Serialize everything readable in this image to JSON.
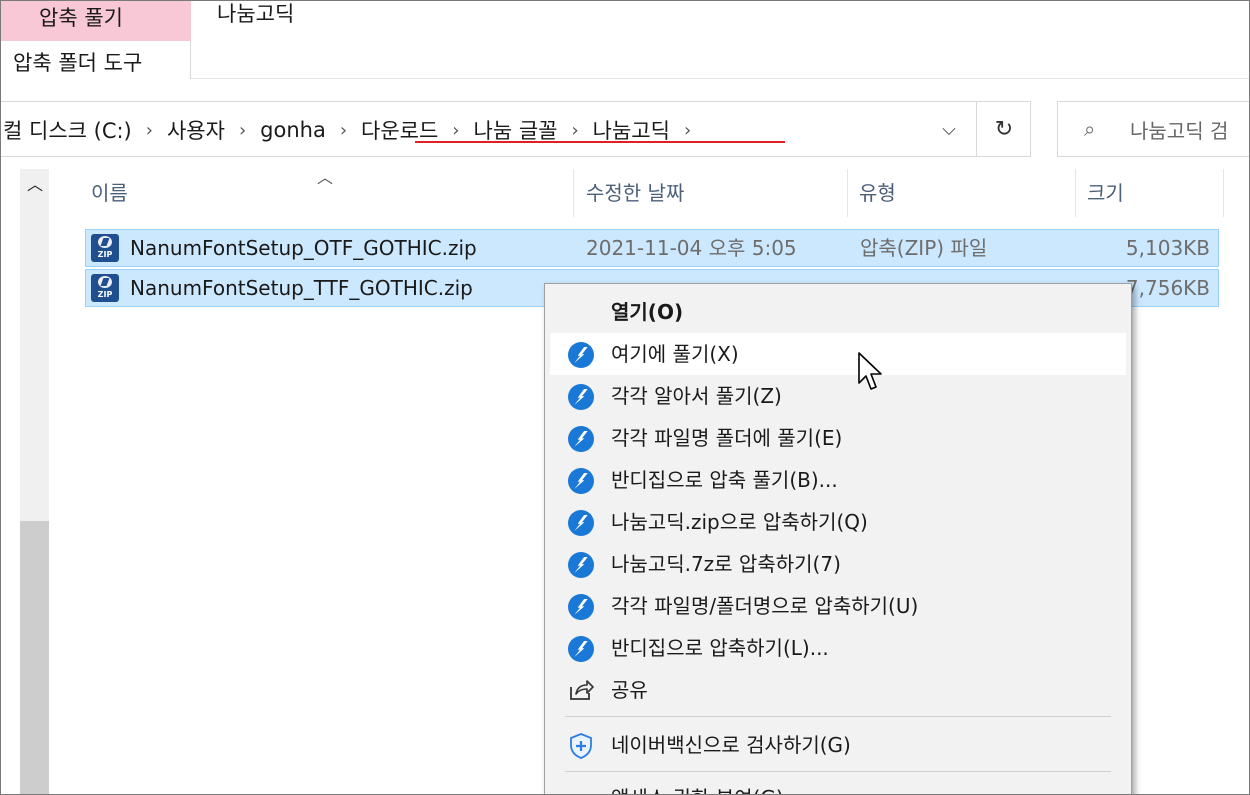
{
  "ribbon": {
    "extract_tab": "압축 풀기",
    "tools_tab": "압축 폴더 도구",
    "folder_tab": "나눔고딕"
  },
  "address": {
    "crumbs": [
      "컬 디스크 (C:)",
      "사용자",
      "gonha",
      "다운로드",
      "나눔 글꼴",
      "나눔고딕"
    ],
    "refresh_icon": "refresh-icon",
    "search_placeholder": "나눔고딕 검"
  },
  "columns": {
    "name": "이름",
    "modified": "수정한 날짜",
    "type": "유형",
    "size": "크기"
  },
  "files": [
    {
      "name": "NanumFontSetup_OTF_GOTHIC.zip",
      "modified": "2021-11-04 오후 5:05",
      "type": "압축(ZIP) 파일",
      "size": "5,103KB"
    },
    {
      "name": "NanumFontSetup_TTF_GOTHIC.zip",
      "modified": "",
      "type": "",
      "size": "7,756KB"
    }
  ],
  "context_menu": {
    "items": [
      {
        "label": "열기(O)",
        "icon": "",
        "bold": true
      },
      {
        "label": "여기에 풀기(X)",
        "icon": "bandizip-icon",
        "highlighted": true
      },
      {
        "label": "각각 알아서 풀기(Z)",
        "icon": "bandizip-icon"
      },
      {
        "label": "각각 파일명 폴더에 풀기(E)",
        "icon": "bandizip-icon"
      },
      {
        "label": "반디집으로 압축 풀기(B)...",
        "icon": "bandizip-icon"
      },
      {
        "label": "나눔고딕.zip으로 압축하기(Q)",
        "icon": "bandizip-icon"
      },
      {
        "label": "나눔고딕.7z로 압축하기(7)",
        "icon": "bandizip-icon"
      },
      {
        "label": "각각 파일명/폴더명으로 압축하기(U)",
        "icon": "bandizip-icon"
      },
      {
        "label": "반디집으로 압축하기(L)...",
        "icon": "bandizip-icon"
      },
      {
        "label": "공유",
        "icon": "share-icon"
      },
      {
        "label": "네이버백신으로 검사하기(G)",
        "icon": "shield-icon"
      },
      {
        "label": "액세스 권한 부여(G)",
        "icon": ""
      }
    ]
  },
  "colors": {
    "selection": "#cce8ff",
    "ribbon_context": "#f8c8d6",
    "bandizip": "#1a78d6",
    "underline": "#e02020"
  }
}
